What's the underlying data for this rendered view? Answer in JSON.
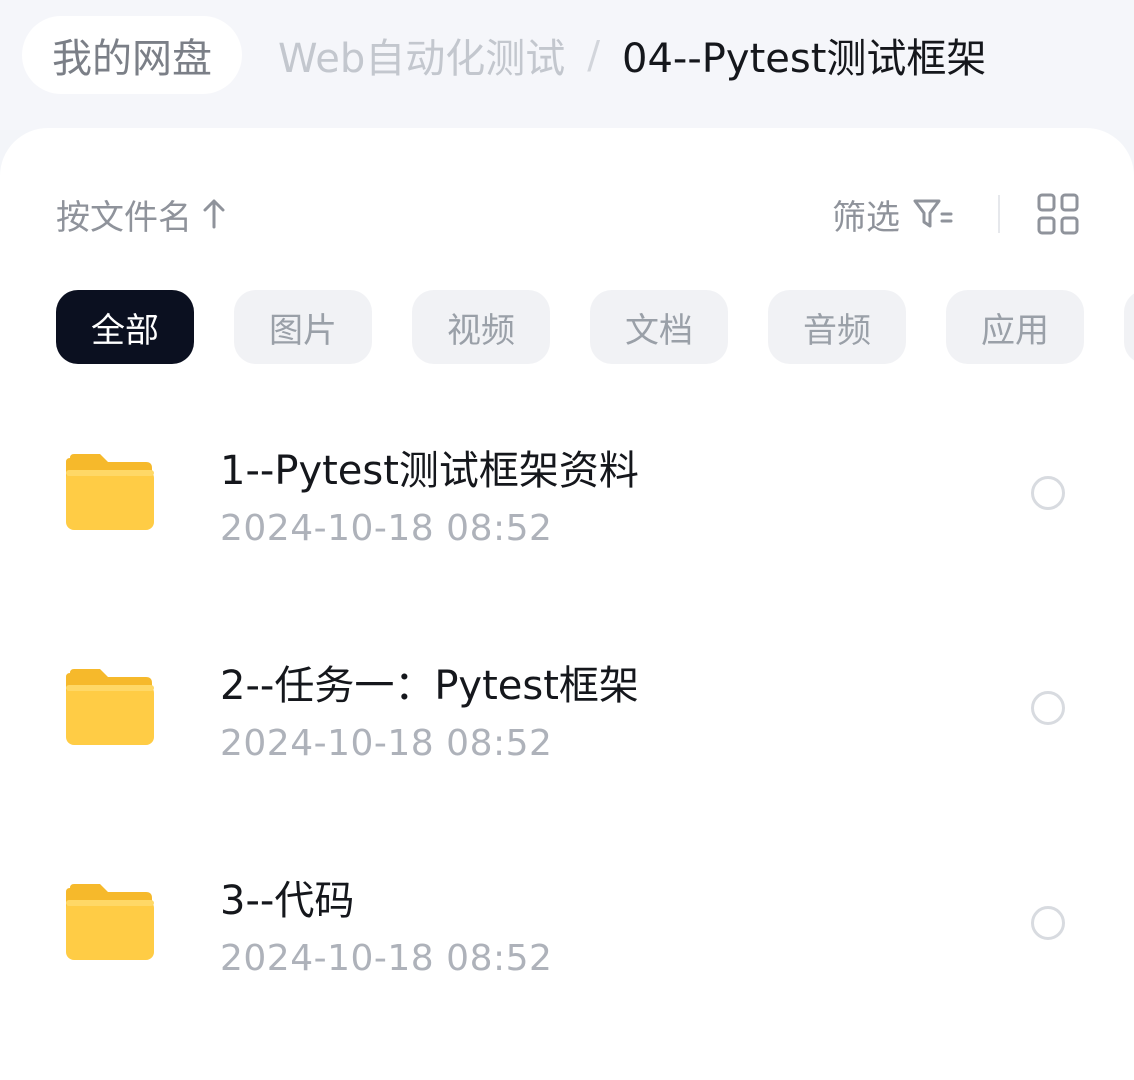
{
  "breadcrumb": {
    "root": "我的网盘",
    "parent": "Web自动化测试",
    "separator": "/",
    "current": "04--Pytest测试框架"
  },
  "toolbar": {
    "sort_label": "按文件名",
    "sort_icon": "arrow-up-icon",
    "filter_label": "筛选",
    "filter_icon": "filter-icon",
    "view_icon": "grid-view-icon"
  },
  "categories": [
    {
      "label": "全部",
      "active": true
    },
    {
      "label": "图片",
      "active": false
    },
    {
      "label": "视频",
      "active": false
    },
    {
      "label": "文档",
      "active": false
    },
    {
      "label": "音频",
      "active": false
    },
    {
      "label": "应用",
      "active": false
    }
  ],
  "files": [
    {
      "name": "1--Pytest测试框架资料",
      "date": "2024-10-18  08:52",
      "icon": "folder-icon"
    },
    {
      "name": "2--任务一：Pytest框架",
      "date": "2024-10-18  08:52",
      "icon": "folder-icon"
    },
    {
      "name": "3--代码",
      "date": "2024-10-18  08:52",
      "icon": "folder-icon"
    }
  ],
  "colors": {
    "accent": "#0b1020",
    "folder": "#ffc83d"
  }
}
